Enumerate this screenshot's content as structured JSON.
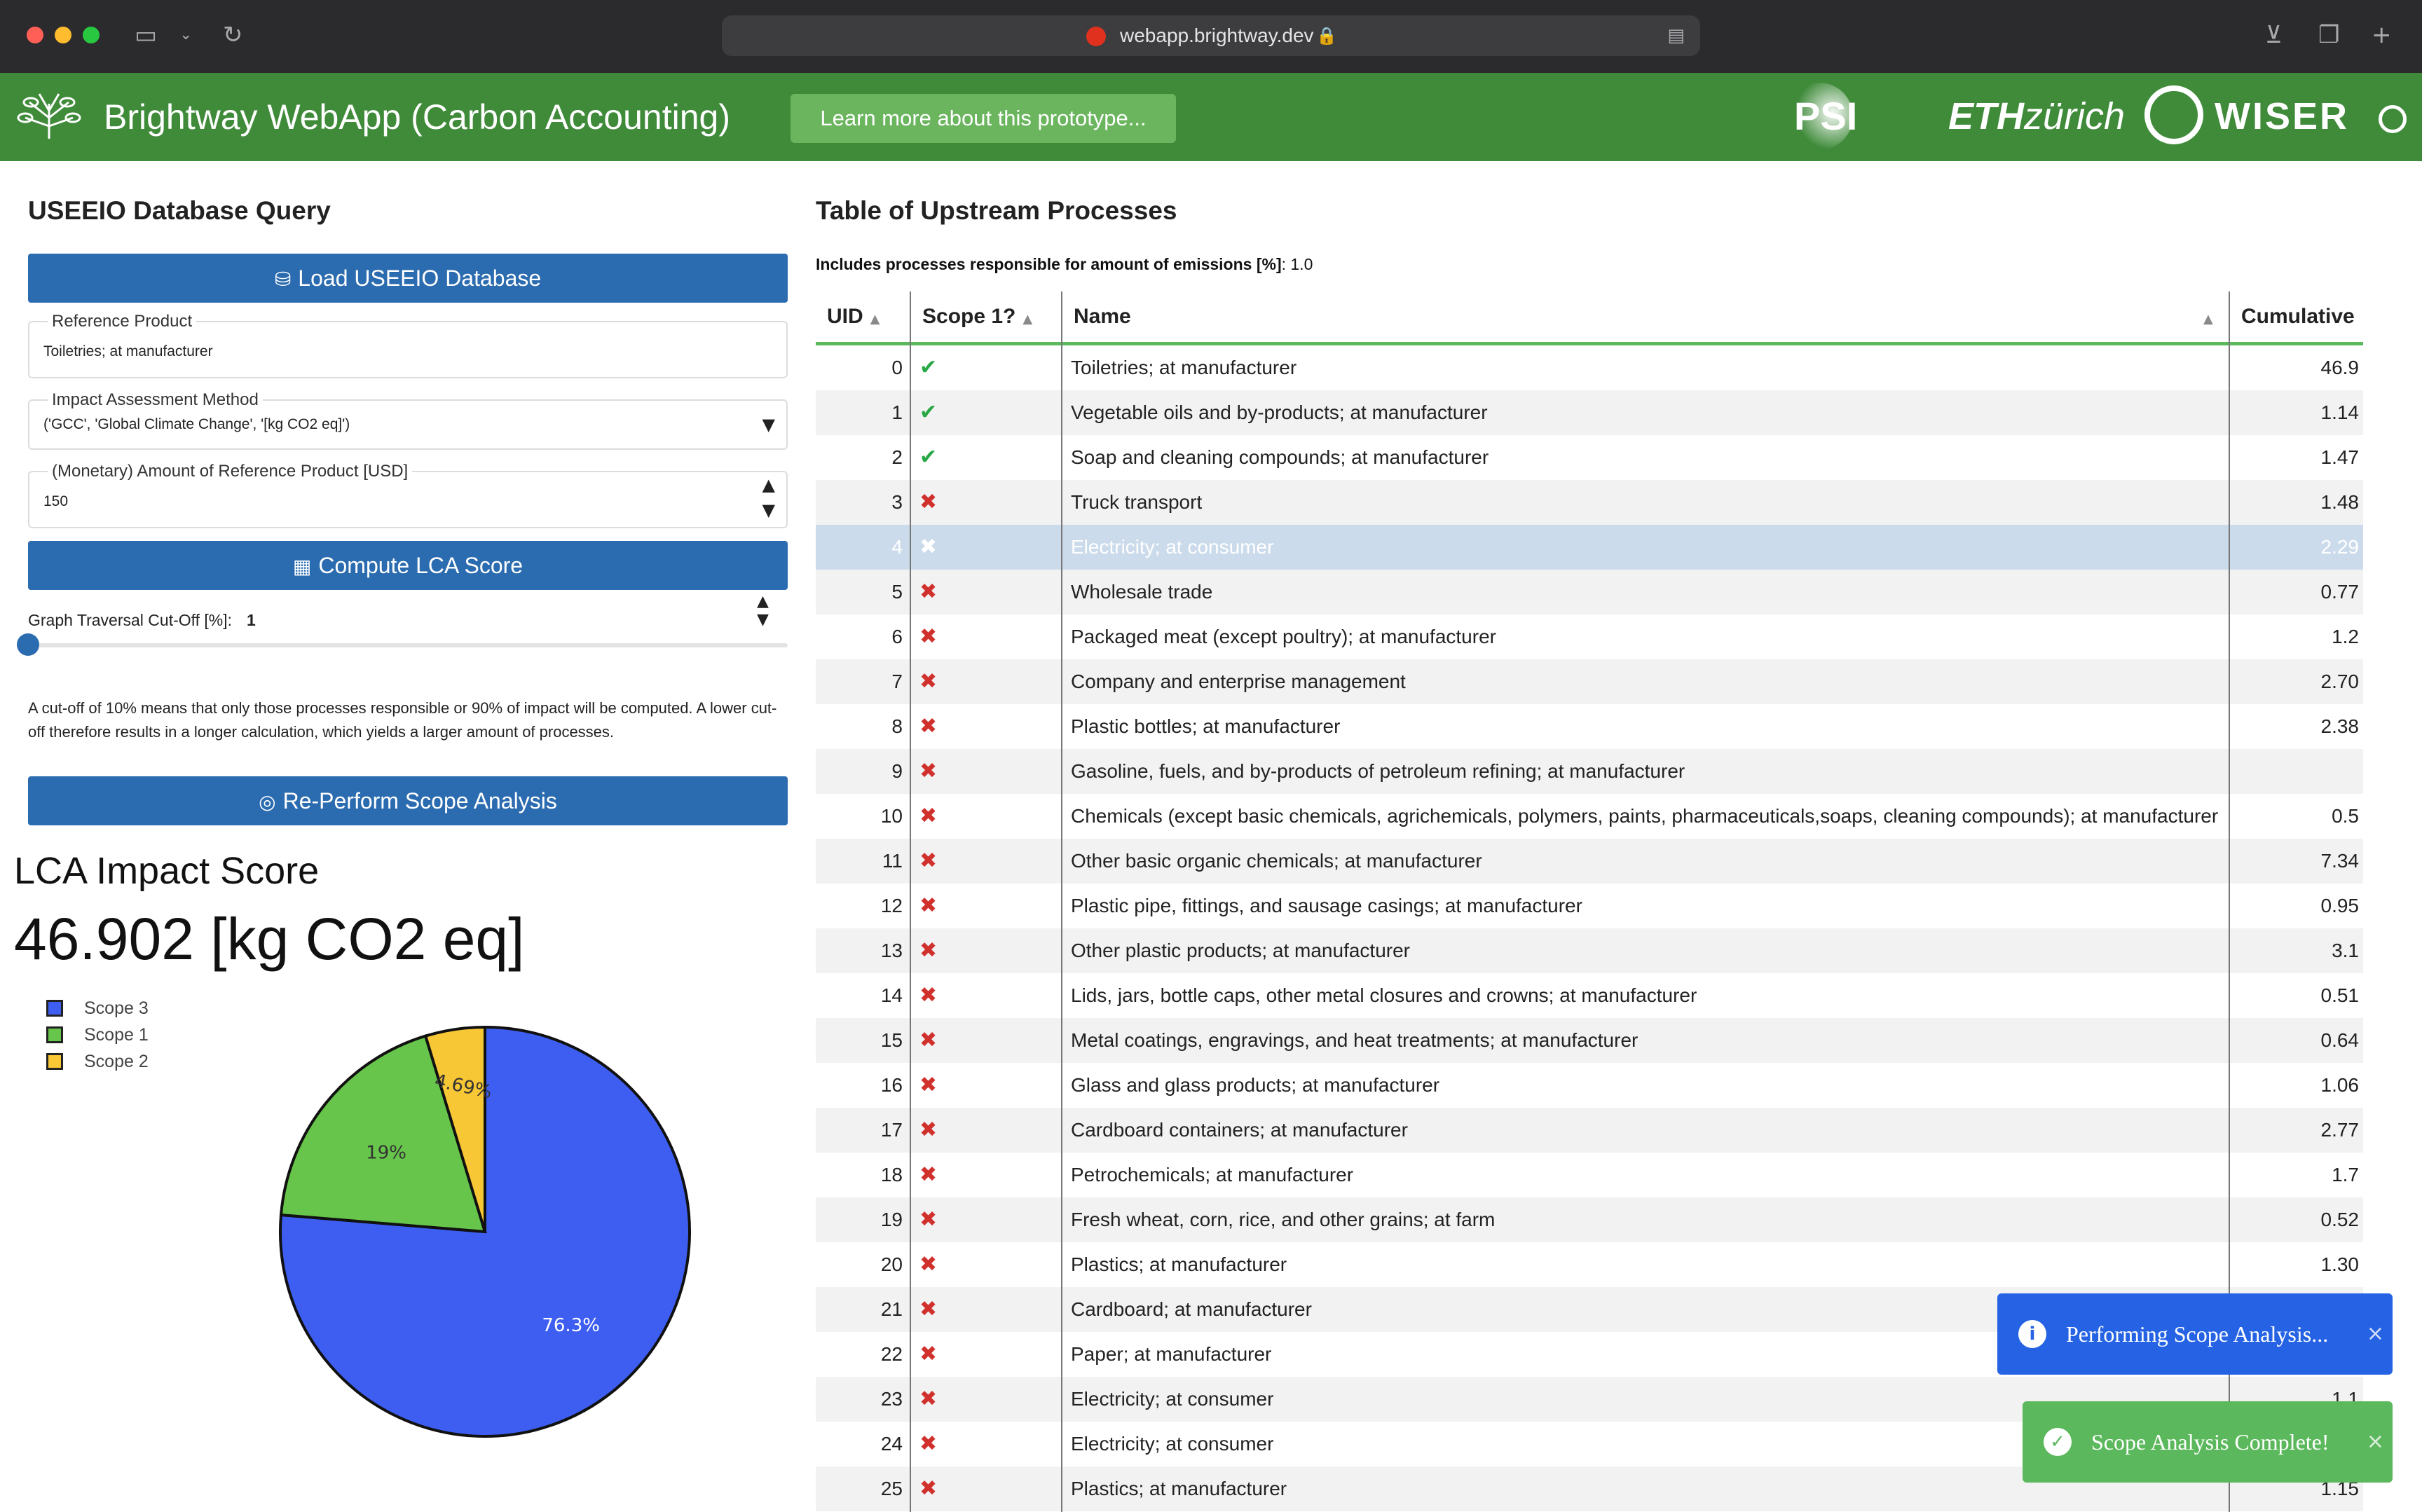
{
  "browser": {
    "url": "webapp.brightway.dev",
    "sidebar_icon": "sidebar-icon",
    "reload_icon": "reload-icon"
  },
  "header": {
    "title": "Brightway WebApp (Carbon Accounting)",
    "learn_more_label": "Learn more about this prototype...",
    "partners": {
      "psi": "PSI",
      "eth_bold": "ETH",
      "eth_light": "zürich",
      "wiser": "WISER"
    }
  },
  "left": {
    "section_title": "USEEIO Database Query",
    "load_button": "Load USEEIO Database",
    "reference_product": {
      "label": "Reference Product",
      "value": "Toiletries; at manufacturer"
    },
    "impact_method": {
      "label": "Impact Assessment Method",
      "value": "('GCC', 'Global Climate Change', '[kg CO2 eq]')"
    },
    "amount": {
      "label": "(Monetary) Amount of Reference Product [USD]",
      "value": "150"
    },
    "compute_button": "Compute LCA Score",
    "cutoff": {
      "label": "Graph Traversal Cut-Off [%]:",
      "value": "1",
      "slider_fraction": 0.0
    },
    "help_text": "A cut-off of 10% means that only those processes responsible or 90% of impact will be computed. A lower cut-off therefore results in a longer calculation, which yields a larger amount of processes.",
    "reperform_button": "Re-Perform Scope Analysis",
    "lca_title": "LCA Impact Score",
    "lca_score": "46.902 [kg CO2 eq]"
  },
  "chart_data": {
    "type": "pie",
    "slices": [
      {
        "name": "Scope 3",
        "value": 76.3,
        "label": "76.3%",
        "color": "#3d5ef0"
      },
      {
        "name": "Scope 1",
        "value": 19.0,
        "label": "19%",
        "color": "#66c54a"
      },
      {
        "name": "Scope 2",
        "value": 4.69,
        "label": "4.69%",
        "color": "#f8c735"
      }
    ],
    "legend": [
      "Scope 3",
      "Scope 1",
      "Scope 2"
    ],
    "legend_position": "top-left"
  },
  "table": {
    "title": "Table of Upstream Processes",
    "filter_label": "Includes processes responsible for amount of emissions [%]",
    "filter_value": ": 1.0",
    "columns": {
      "uid": "UID",
      "scope1": "Scope 1?",
      "name": "Name",
      "cumulative": "Cumulative"
    },
    "selected_uid": "4",
    "rows": [
      {
        "uid": "0",
        "scope1": true,
        "name": "Toiletries; at manufacturer",
        "cum": "46.9"
      },
      {
        "uid": "1",
        "scope1": true,
        "name": "Vegetable oils and by-products; at manufacturer",
        "cum": "1.14"
      },
      {
        "uid": "2",
        "scope1": true,
        "name": "Soap and cleaning compounds; at manufacturer",
        "cum": "1.47"
      },
      {
        "uid": "3",
        "scope1": false,
        "name": "Truck transport",
        "cum": "1.48"
      },
      {
        "uid": "4",
        "scope1": false,
        "name": "Electricity; at consumer",
        "cum": "2.29"
      },
      {
        "uid": "5",
        "scope1": false,
        "name": "Wholesale trade",
        "cum": "0.77"
      },
      {
        "uid": "6",
        "scope1": false,
        "name": "Packaged meat (except poultry); at manufacturer",
        "cum": "1.2"
      },
      {
        "uid": "7",
        "scope1": false,
        "name": "Company and enterprise management",
        "cum": "2.70"
      },
      {
        "uid": "8",
        "scope1": false,
        "name": "Plastic bottles; at manufacturer",
        "cum": "2.38"
      },
      {
        "uid": "9",
        "scope1": false,
        "name": "Gasoline, fuels, and by-products of petroleum refining; at manufacturer",
        "cum": ""
      },
      {
        "uid": "10",
        "scope1": false,
        "name": "Chemicals (except basic chemicals, agrichemicals, polymers, paints, pharmaceuticals,soaps, cleaning compounds); at manufacturer",
        "cum": "0.5"
      },
      {
        "uid": "11",
        "scope1": false,
        "name": "Other basic organic chemicals; at manufacturer",
        "cum": "7.34"
      },
      {
        "uid": "12",
        "scope1": false,
        "name": "Plastic pipe, fittings, and sausage casings; at manufacturer",
        "cum": "0.95"
      },
      {
        "uid": "13",
        "scope1": false,
        "name": "Other plastic products; at manufacturer",
        "cum": "3.1"
      },
      {
        "uid": "14",
        "scope1": false,
        "name": "Lids, jars, bottle caps, other metal closures and crowns; at manufacturer",
        "cum": "0.51"
      },
      {
        "uid": "15",
        "scope1": false,
        "name": "Metal coatings, engravings, and heat treatments; at manufacturer",
        "cum": "0.64"
      },
      {
        "uid": "16",
        "scope1": false,
        "name": "Glass and glass products; at manufacturer",
        "cum": "1.06"
      },
      {
        "uid": "17",
        "scope1": false,
        "name": "Cardboard containers; at manufacturer",
        "cum": "2.77"
      },
      {
        "uid": "18",
        "scope1": false,
        "name": "Petrochemicals; at manufacturer",
        "cum": "1.7"
      },
      {
        "uid": "19",
        "scope1": false,
        "name": "Fresh wheat, corn, rice, and other grains; at farm",
        "cum": "0.52"
      },
      {
        "uid": "20",
        "scope1": false,
        "name": "Plastics; at manufacturer",
        "cum": "1.30"
      },
      {
        "uid": "21",
        "scope1": false,
        "name": "Cardboard; at manufacturer",
        "cum": ""
      },
      {
        "uid": "22",
        "scope1": false,
        "name": "Paper; at manufacturer",
        "cum": ""
      },
      {
        "uid": "23",
        "scope1": false,
        "name": "Electricity; at consumer",
        "cum": "1.1"
      },
      {
        "uid": "24",
        "scope1": false,
        "name": "Electricity; at consumer",
        "cum": ""
      },
      {
        "uid": "25",
        "scope1": false,
        "name": "Plastics; at manufacturer",
        "cum": "1.15"
      }
    ]
  },
  "toasts": {
    "info": "Performing Scope Analysis...",
    "success": "Scope Analysis Complete!"
  }
}
